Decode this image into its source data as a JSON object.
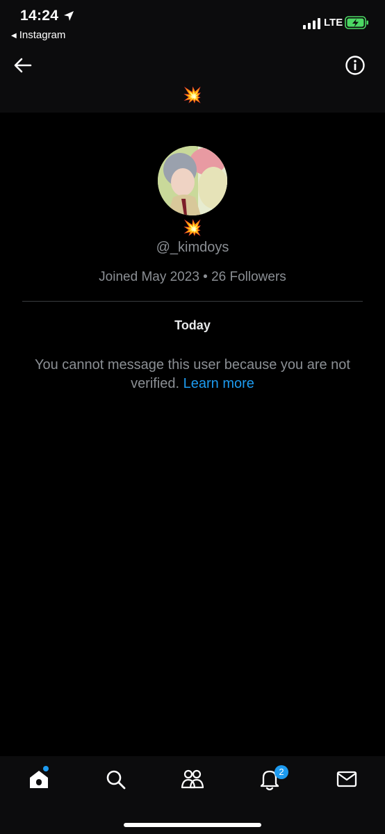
{
  "status_bar": {
    "time": "14:24",
    "back_app": "Instagram",
    "network": "LTE",
    "icons": [
      "location-arrow-icon",
      "signal-bars-icon",
      "battery-charging-icon"
    ]
  },
  "header": {
    "title_emoji": "💥",
    "back_icon": "arrow-left-icon",
    "info_icon": "info-circle-icon"
  },
  "profile": {
    "display_name_emoji": "💥",
    "handle": "@_kimdoys",
    "joined": "Joined May 2023 • 26 Followers"
  },
  "conversation": {
    "date_separator": "Today",
    "notice_text": "You cannot message this user because you are not verified. ",
    "notice_link": "Learn more"
  },
  "tab_bar": {
    "items": [
      {
        "name": "home",
        "icon": "home-icon",
        "has_dot": true
      },
      {
        "name": "search",
        "icon": "search-icon"
      },
      {
        "name": "communities",
        "icon": "people-icon"
      },
      {
        "name": "notifications",
        "icon": "bell-icon",
        "badge": "2"
      },
      {
        "name": "messages",
        "icon": "envelope-icon"
      }
    ]
  },
  "colors": {
    "background": "#000000",
    "header": "#0c0c0d",
    "accent": "#1d9bf0",
    "secondary_text": "#8b8f94"
  }
}
